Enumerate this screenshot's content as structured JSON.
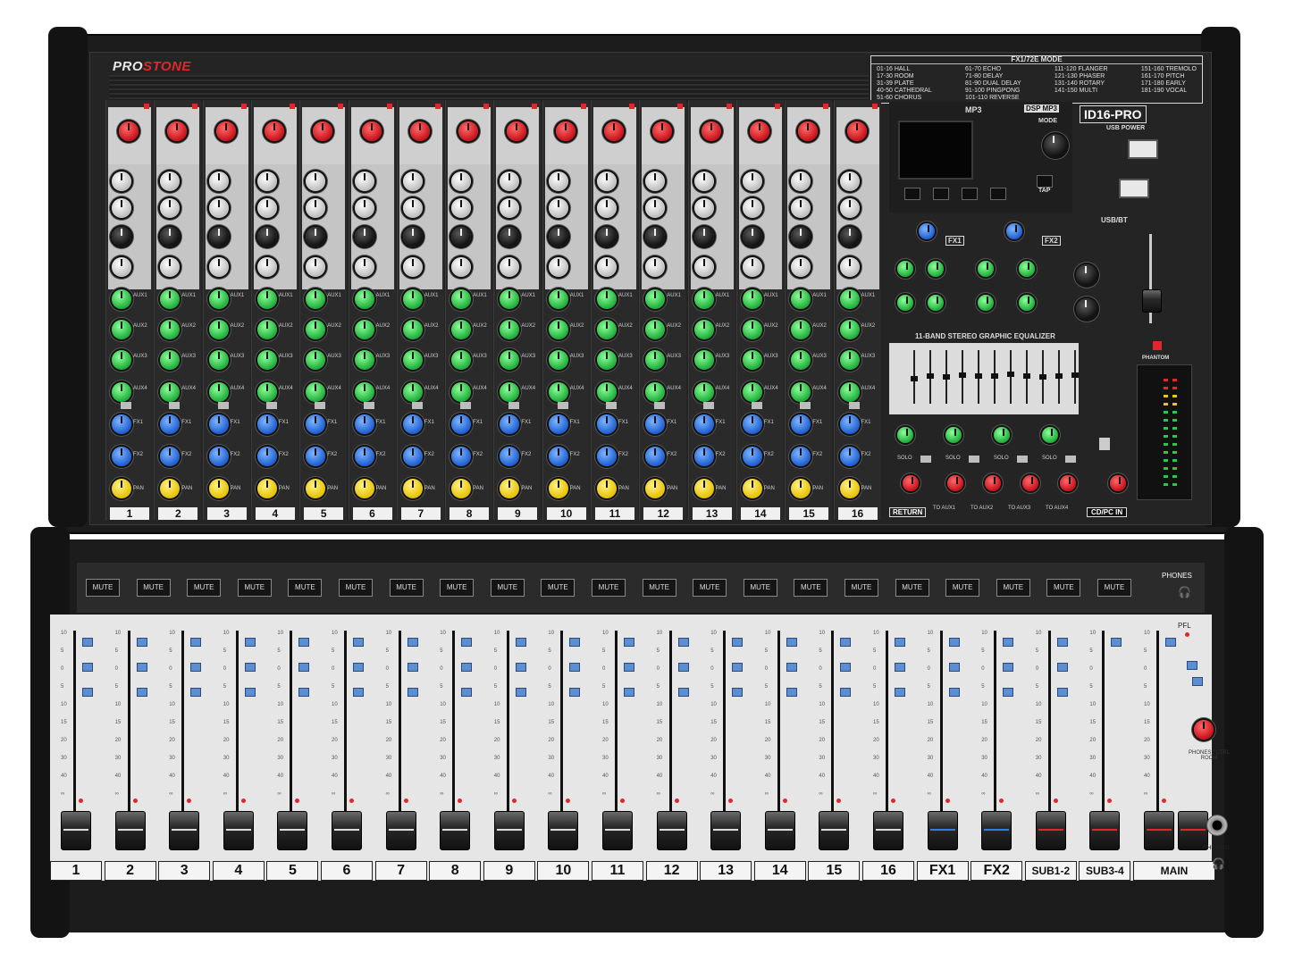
{
  "brand": {
    "pro": "PRO",
    "stone": "STONE"
  },
  "model": "ID16-PRO",
  "fx_modes": {
    "title": "FX1/72E MODE",
    "col1": [
      "01-16 HALL",
      "17-30 ROOM",
      "31-39 PLATE",
      "40-50 CATHEDRAL",
      "51-60 CHORUS"
    ],
    "col2": [
      "61-70 ECHO",
      "71-80 DELAY",
      "81-90 DUAL DELAY",
      "91-100 PINGPONG",
      "101-110 REVERSE"
    ],
    "col3": [
      "111-120 FLANGER",
      "121-130 PHASER",
      "131-140 ROTARY",
      "141-150 MULTI"
    ],
    "col4": [
      "151-160 TREMOLO",
      "161-170 PITCH",
      "171-180 EARLY",
      "181-190 VOCAL"
    ]
  },
  "top_channels": [
    "1",
    "2",
    "3",
    "4",
    "5",
    "6",
    "7",
    "8",
    "9",
    "10",
    "11",
    "12",
    "13",
    "14",
    "15",
    "16"
  ],
  "dsp": {
    "header": "DSP MP3",
    "mp3": "MP3",
    "mode": "MODE",
    "tap": "TAP",
    "usb_power": "USB POWER",
    "usb_bt": "USB/BT",
    "fx1": "FX1",
    "fx2": "FX2",
    "eq_title": "11-BAND STEREO GRAPHIC EQUALIZER",
    "phantom": "PHANTOM",
    "solo": "SOLO",
    "cd_pc_in": "CD/PC IN",
    "return": "RETURN",
    "to_aux": [
      "TO AUX1",
      "TO AUX2",
      "TO AUX3",
      "TO AUX4"
    ]
  },
  "knob_labels": {
    "aux1": "AUX1",
    "aux2": "AUX2",
    "aux3": "AUX3",
    "aux4": "AUX4",
    "fx1": "FX1",
    "fx2": "FX2",
    "pan": "PAN"
  },
  "mute_label": "MUTE",
  "phones": {
    "top": "PHONES",
    "pfl": "PFL",
    "ctrl": "PHONES / CTRL ROOM",
    "jack": "PHONES"
  },
  "fader_labels": [
    "1",
    "2",
    "3",
    "4",
    "5",
    "6",
    "7",
    "8",
    "9",
    "10",
    "11",
    "12",
    "13",
    "14",
    "15",
    "16",
    "FX1",
    "FX2",
    "SUB1-2",
    "SUB3-4",
    "MAIN"
  ],
  "colors": {
    "accent_red": "#e3262b",
    "knob_green": "#1fae3a",
    "knob_blue": "#1f5fd0",
    "knob_yellow": "#e6c200",
    "switch_blue": "#5b8fd1"
  }
}
